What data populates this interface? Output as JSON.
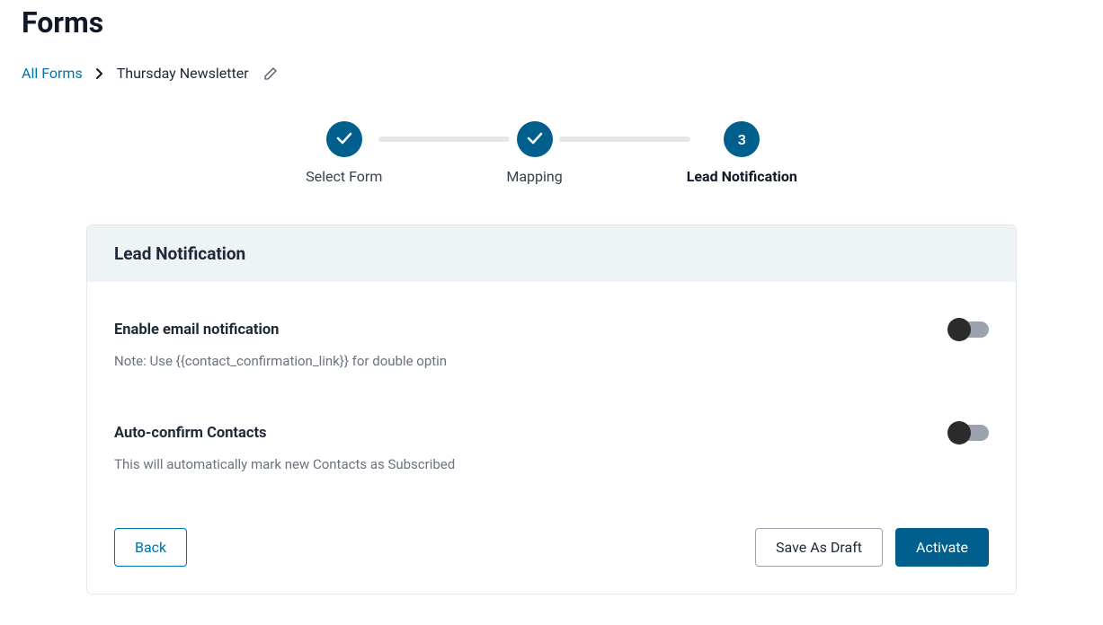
{
  "page": {
    "title": "Forms"
  },
  "breadcrumb": {
    "root": "All Forms",
    "current": "Thursday Newsletter"
  },
  "stepper": {
    "steps": [
      {
        "label": "Select Form",
        "state": "done"
      },
      {
        "label": "Mapping",
        "state": "done"
      },
      {
        "label": "Lead Notification",
        "state": "current",
        "number": "3"
      }
    ]
  },
  "card": {
    "header": "Lead Notification",
    "settings": {
      "email_notification": {
        "title": "Enable email notification",
        "note": "Note: Use {{contact_confirmation_link}} for double optin",
        "enabled": false
      },
      "auto_confirm": {
        "title": "Auto-confirm Contacts",
        "note": "This will automatically mark new Contacts as Subscribed",
        "enabled": false
      }
    },
    "buttons": {
      "back": "Back",
      "save_draft": "Save As Draft",
      "activate": "Activate"
    }
  }
}
